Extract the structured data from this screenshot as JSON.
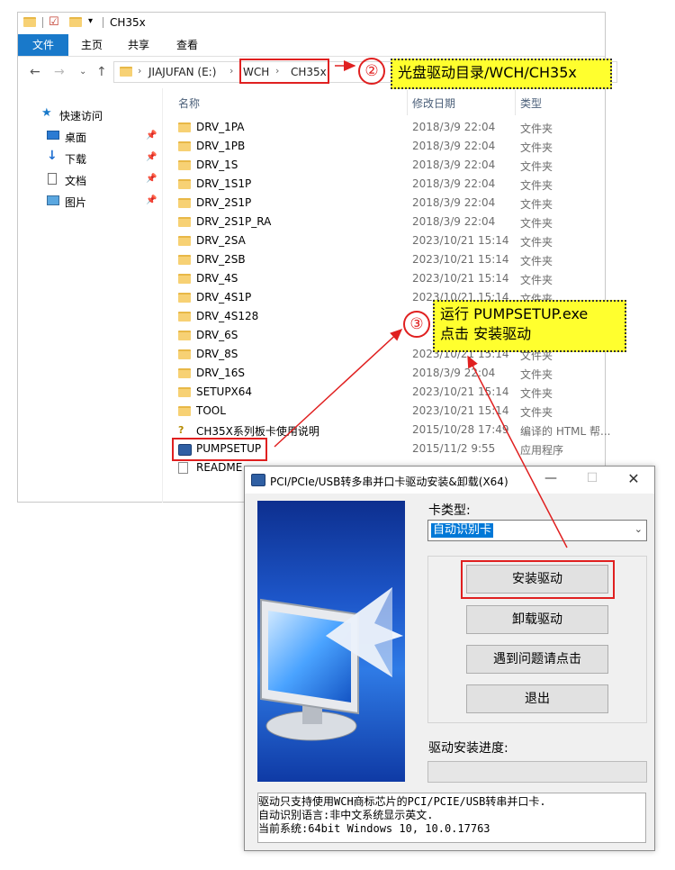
{
  "explorer": {
    "window_title": "CH35x",
    "ribbon_tabs": [
      "文件",
      "主页",
      "共享",
      "查看"
    ],
    "breadcrumb": [
      "JIAJUFAN (E:)",
      "WCH",
      "CH35x"
    ],
    "nav_pane": [
      {
        "label": "快速访问",
        "icon": "star-icon"
      },
      {
        "label": "桌面",
        "icon": "desktop-icon"
      },
      {
        "label": "下载",
        "icon": "download-icon"
      },
      {
        "label": "文档",
        "icon": "document-icon"
      },
      {
        "label": "图片",
        "icon": "picture-icon"
      }
    ],
    "columns": {
      "name": "名称",
      "date": "修改日期",
      "type": "类型"
    },
    "files": [
      {
        "name": "DRV_1PA",
        "date": "2018/3/9 22:04",
        "type": "文件夹",
        "kind": "folder"
      },
      {
        "name": "DRV_1PB",
        "date": "2018/3/9 22:04",
        "type": "文件夹",
        "kind": "folder"
      },
      {
        "name": "DRV_1S",
        "date": "2018/3/9 22:04",
        "type": "文件夹",
        "kind": "folder"
      },
      {
        "name": "DRV_1S1P",
        "date": "2018/3/9 22:04",
        "type": "文件夹",
        "kind": "folder"
      },
      {
        "name": "DRV_2S1P",
        "date": "2018/3/9 22:04",
        "type": "文件夹",
        "kind": "folder"
      },
      {
        "name": "DRV_2S1P_RA",
        "date": "2018/3/9 22:04",
        "type": "文件夹",
        "kind": "folder"
      },
      {
        "name": "DRV_2SA",
        "date": "2023/10/21 15:14",
        "type": "文件夹",
        "kind": "folder"
      },
      {
        "name": "DRV_2SB",
        "date": "2023/10/21 15:14",
        "type": "文件夹",
        "kind": "folder"
      },
      {
        "name": "DRV_4S",
        "date": "2023/10/21 15:14",
        "type": "文件夹",
        "kind": "folder"
      },
      {
        "name": "DRV_4S1P",
        "date": "2023/10/21 15:14",
        "type": "文件夹",
        "kind": "folder"
      },
      {
        "name": "DRV_4S128",
        "date": "",
        "type": "",
        "kind": "folder"
      },
      {
        "name": "DRV_6S",
        "date": "",
        "type": "",
        "kind": "folder"
      },
      {
        "name": "DRV_8S",
        "date": "2023/10/21 15:14",
        "type": "文件夹",
        "kind": "folder"
      },
      {
        "name": "DRV_16S",
        "date": "2018/3/9 22:04",
        "type": "文件夹",
        "kind": "folder"
      },
      {
        "name": "SETUPX64",
        "date": "2023/10/21 15:14",
        "type": "文件夹",
        "kind": "folder"
      },
      {
        "name": "TOOL",
        "date": "2023/10/21 15:14",
        "type": "文件夹",
        "kind": "folder"
      },
      {
        "name": "CH35X系列板卡使用说明",
        "date": "2015/10/28 17:49",
        "type": "编译的 HTML 帮...",
        "kind": "help"
      },
      {
        "name": "PUMPSETUP",
        "date": "2015/11/2 9:55",
        "type": "应用程序",
        "kind": "exe"
      },
      {
        "name": "README",
        "date": "",
        "type": "",
        "kind": "file"
      }
    ]
  },
  "callouts": {
    "step2_num": "②",
    "step2_text": "光盘驱动目录/WCH/CH35x",
    "step3_num": "③",
    "step3_line1": "运行 PUMPSETUP.exe",
    "step3_line2": "点击 安装驱动"
  },
  "dialog": {
    "title": "PCI/PCIe/USB转多串并口卡驱动安装&卸载(X64)",
    "card_type_label": "卡类型:",
    "card_type_value": "自动识别卡",
    "buttons": {
      "install": "安装驱动",
      "uninstall": "卸载驱动",
      "help": "遇到问题请点击",
      "exit": "退出"
    },
    "progress_label": "驱动安装进度:",
    "progress": 0,
    "info_lines": [
      "驱动只支持使用WCH商标芯片的PCI/PCIE/USB转串并口卡.",
      "自动识别语言:非中文系统显示英文.",
      "当前系统:64bit Windows 10, 10.0.17763"
    ]
  },
  "colors": {
    "accent": "#1979ca",
    "highlight_red": "#e02020",
    "callout_yellow": "#ffff2e",
    "folder": "#f7d174"
  }
}
